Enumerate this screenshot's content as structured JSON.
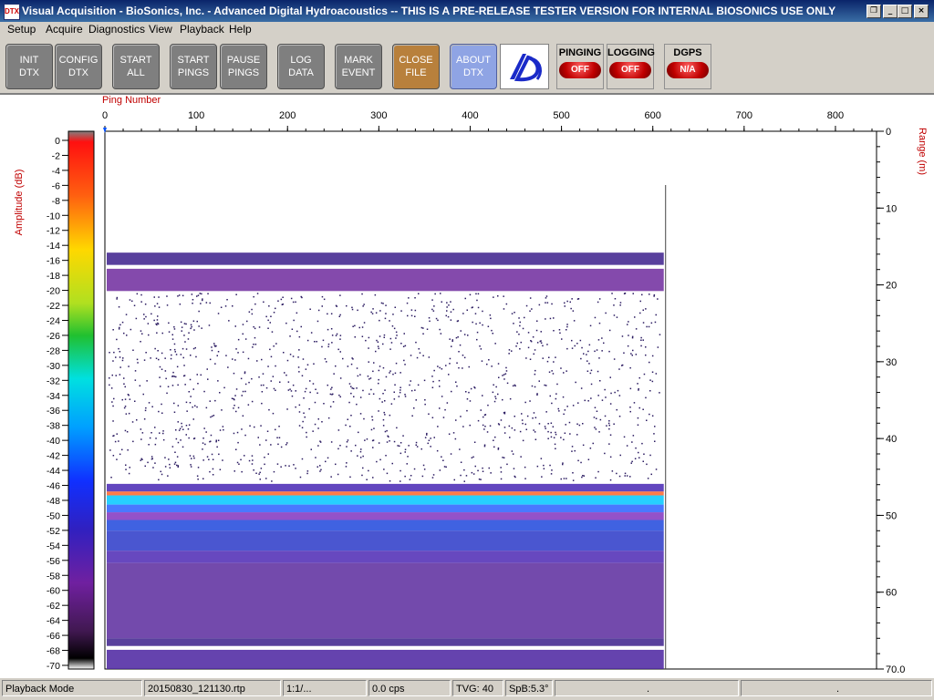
{
  "window": {
    "icon_text": "DTX",
    "title": "Visual Acquisition  -  BioSonics, Inc.  -  Advanced Digital Hydroacoustics  -- THIS IS A PRE-RELEASE TESTER VERSION FOR INTERNAL BIOSONICS USE ONLY",
    "controls": [
      "❐",
      "_",
      "□",
      "×"
    ]
  },
  "menu": [
    "Setup",
    "Acquire",
    "Diagnostics",
    "View",
    "Playback",
    "Help"
  ],
  "toolbar": {
    "buttons": [
      {
        "label": "INIT\nDTX"
      },
      {
        "label": "CONFIG\nDTX"
      },
      {
        "label": "START\nALL"
      },
      {
        "label": "START\nPINGS"
      },
      {
        "label": "PAUSE\nPINGS"
      },
      {
        "label": "LOG\nDATA"
      },
      {
        "label": "MARK\nEVENT"
      },
      {
        "label": "CLOSE\nFILE"
      },
      {
        "label": "ABOUT\nDTX"
      }
    ],
    "status": [
      {
        "label": "PINGING",
        "value": "OFF"
      },
      {
        "label": "LOGGING",
        "value": "OFF"
      },
      {
        "label": "DGPS",
        "value": "N/A"
      }
    ]
  },
  "echogram": {
    "x_axis_title": "Ping Number",
    "x_ticks": [
      0,
      100,
      200,
      300,
      400,
      500,
      600,
      700,
      800
    ],
    "left_axis_title": "Amplitude (dB)",
    "right_axis_title": "Range (m)",
    "range_ticks": [
      "0",
      "10",
      "20",
      "30",
      "40",
      "50",
      "60",
      "70.0"
    ],
    "amplitude_ticks": [
      "0",
      "-2",
      "-4",
      "-6",
      "-8",
      "-10",
      "-12",
      "-14",
      "-16",
      "-18",
      "-20",
      "-22",
      "-24",
      "-26",
      "-28",
      "-30",
      "-32",
      "-34",
      "-36",
      "-38",
      "-40",
      "-42",
      "-44",
      "-46",
      "-48",
      "-50",
      "-52",
      "-54",
      "-56",
      "-58",
      "-60",
      "-62",
      "-64",
      "-66",
      "-68",
      "-70"
    ],
    "amplitude_range": [
      0,
      -70
    ],
    "range_span_m": [
      0,
      70
    ],
    "ping_span": [
      0,
      845
    ],
    "pings_recorded": 612,
    "bands": [
      {
        "from_m": 15.8,
        "to_m": 17.4,
        "color": "#3c1e8c"
      },
      {
        "from_m": 17.9,
        "to_m": 20.8,
        "color": "#6e2a9e"
      },
      {
        "from_m": 45.9,
        "to_m": 46.9,
        "color": "#4626b4"
      },
      {
        "from_m": 46.9,
        "to_m": 47.4,
        "color": "#ff6428"
      },
      {
        "from_m": 47.4,
        "to_m": 48.6,
        "color": "#00c8ff"
      },
      {
        "from_m": 48.6,
        "to_m": 49.6,
        "color": "#2a60ff"
      },
      {
        "from_m": 49.6,
        "to_m": 50.6,
        "color": "#8034c0"
      },
      {
        "from_m": 50.6,
        "to_m": 52.0,
        "color": "#1e46dc"
      },
      {
        "from_m": 52.0,
        "to_m": 54.6,
        "color": "#2a38c8"
      },
      {
        "from_m": 54.6,
        "to_m": 56.2,
        "color": "#4c28b4"
      },
      {
        "from_m": 56.2,
        "to_m": 66.0,
        "color": "#5a2a9e"
      },
      {
        "from_m": 66.0,
        "to_m": 67.0,
        "color": "#3c1e8c"
      },
      {
        "from_m": 67.5,
        "to_m": 70.0,
        "color": "#4a22a0"
      }
    ]
  },
  "statusbar": [
    "Playback Mode",
    "20150830_121130.rtp",
    "1:1/...",
    "0.0 cps",
    "TVG: 40",
    "SpB:5.3°",
    ".",
    "."
  ]
}
